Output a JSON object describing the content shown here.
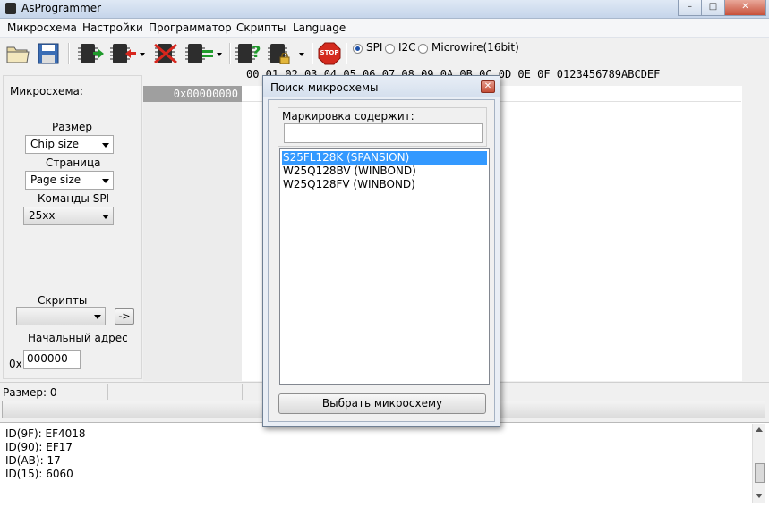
{
  "window": {
    "title": "AsProgrammer",
    "controls": [
      "–",
      "□",
      "✕"
    ]
  },
  "menu": [
    "Микросхема",
    "Настройки",
    "Программатор",
    "Скрипты",
    "Language"
  ],
  "toolbar": {
    "stop_label": "STOP",
    "protocols": [
      "SPI",
      "I2C",
      "Microwire(16bit)"
    ],
    "selected_protocol": "SPI"
  },
  "left_panel": {
    "chip_label": "Микросхема:",
    "size_label": "Размер",
    "size_value": "Chip size",
    "page_label": "Страница",
    "page_value": "Page size",
    "spi_cmd_label": "Команды SPI",
    "spi_cmd_value": "25xx",
    "scripts_label": "Скрипты",
    "scripts_value": "",
    "run_button": "->",
    "start_addr_label": "Начальный адрес",
    "start_addr_prefix": "0x",
    "start_addr_value": "000000"
  },
  "hex_view": {
    "header": "00 01 02 03 04 05 06 07  08 09 0A 0B 0C 0D 0E 0F  0123456789ABCDEF",
    "first_address": "0x00000000"
  },
  "status": {
    "size_text": "Размер: 0"
  },
  "log": [
    "ID(9F): EF4018",
    "ID(90): EF17",
    "ID(AB): 17",
    "ID(15): 6060"
  ],
  "dialog": {
    "title": "Поиск микросхемы",
    "filter_label": "Маркировка содержит:",
    "filter_value": "",
    "items": [
      "S25FL128K (SPANSION)",
      "W25Q128BV (WINBOND)",
      "W25Q128FV (WINBOND)"
    ],
    "selected_index": 0,
    "select_button": "Выбрать микросхему"
  }
}
